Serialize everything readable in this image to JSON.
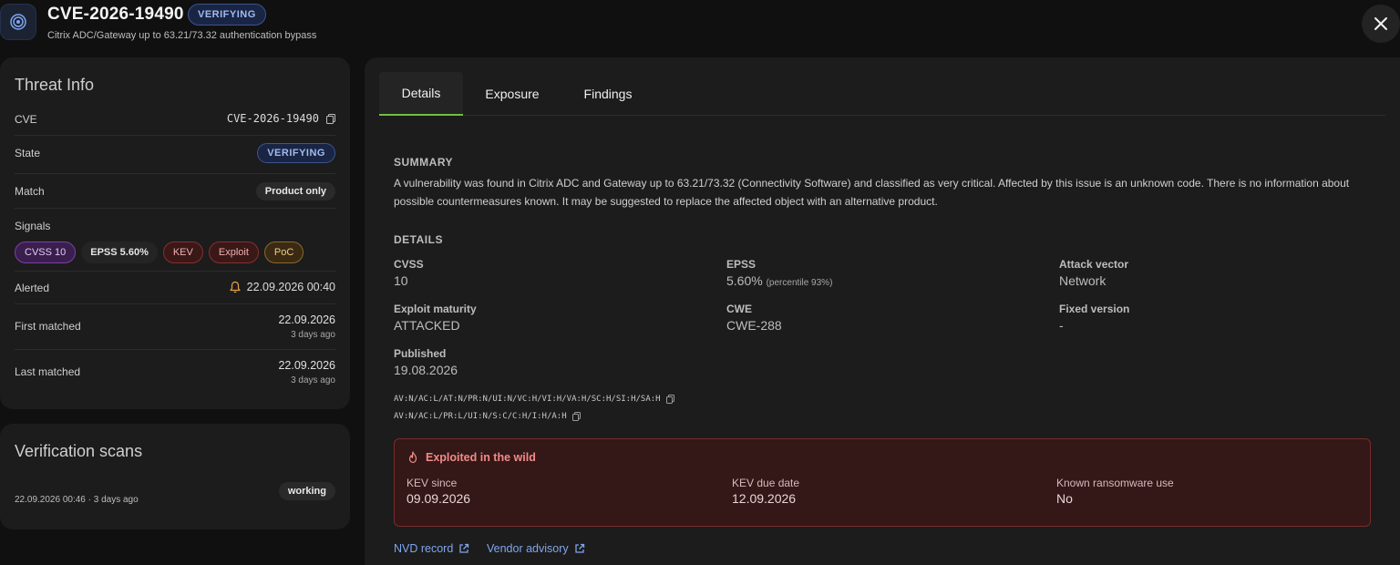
{
  "header": {
    "title": "CVE-2026-19490",
    "badge": "VERIFYING",
    "subtitle": "Citrix ADC/Gateway up to 63.21/73.32 authentication bypass",
    "icon": "target-icon",
    "close_icon": "close-icon"
  },
  "threat_info": {
    "title": "Threat Info",
    "rows": {
      "cve": {
        "label": "CVE",
        "value": "CVE-2026-19490"
      },
      "state": {
        "label": "State",
        "value": "VERIFYING"
      },
      "match": {
        "label": "Match",
        "value": "Product only"
      },
      "signals": {
        "label": "Signals",
        "items": [
          "CVSS 10",
          "EPSS 5.60%",
          "KEV",
          "Exploit",
          "PoC"
        ]
      },
      "alerted": {
        "label": "Alerted",
        "value": "22.09.2026 00:40"
      },
      "first_matched": {
        "label": "First matched",
        "date": "22.09.2026",
        "ago": "3 days ago"
      },
      "last_matched": {
        "label": "Last matched",
        "date": "22.09.2026",
        "ago": "3 days ago"
      }
    }
  },
  "verification_scans": {
    "title": "Verification scans",
    "scan": {
      "time": "22.09.2026 00:46 · 3 days ago",
      "status": "working"
    }
  },
  "tabs": [
    "Details",
    "Exposure",
    "Findings"
  ],
  "active_tab": "Details",
  "summary": {
    "label": "SUMMARY",
    "text": "A vulnerability was found in Citrix ADC and Gateway up to 63.21/73.32 (Connectivity Software) and classified as very critical. Affected by this issue is an unknown code. There is no information about possible countermeasures known. It may be suggested to replace the affected object with an alternative product."
  },
  "details": {
    "label": "DETAILS",
    "cvss": {
      "label": "CVSS",
      "value": "10"
    },
    "epss": {
      "label": "EPSS",
      "value": "5.60%",
      "note": "(percentile 93%)"
    },
    "attack_vector": {
      "label": "Attack vector",
      "value": "Network"
    },
    "exploit_maturity": {
      "label": "Exploit maturity",
      "value": "ATTACKED"
    },
    "cwe": {
      "label": "CWE",
      "value": "CWE-288"
    },
    "fixed_version": {
      "label": "Fixed version",
      "value": "-"
    },
    "published": {
      "label": "Published",
      "value": "19.08.2026"
    },
    "vectors": [
      "AV:N/AC:L/AT:N/PR:N/UI:N/VC:H/VI:H/VA:H/SC:H/SI:H/SA:H",
      "AV:N/AC:L/PR:L/UI:N/S:C/C:H/I:H/A:H"
    ]
  },
  "kev": {
    "heading": "Exploited in the wild",
    "since": {
      "label": "KEV since",
      "value": "09.09.2026"
    },
    "due": {
      "label": "KEV due date",
      "value": "12.09.2026"
    },
    "ransomware": {
      "label": "Known ransomware use",
      "value": "No"
    }
  },
  "links": {
    "nvd": "NVD record",
    "vendor": "Vendor advisory"
  },
  "colors": {
    "accent_tab": "#6fbf3f",
    "verifying": "#9fbaf0",
    "danger": "#f28a8a",
    "link": "#7ea6f0"
  }
}
